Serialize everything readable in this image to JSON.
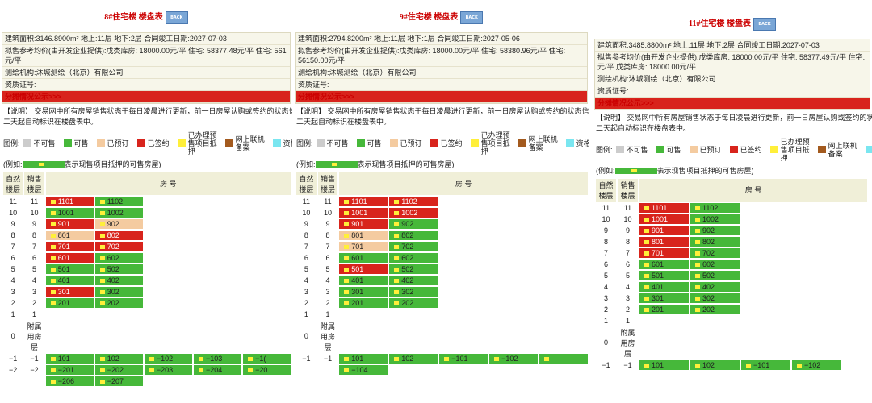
{
  "common": {
    "back_icon_text": "BACK",
    "notice": "【说明】 交易网中所有房屋销售状态于每日凌晨进行更新，前一日房屋认购或签约的状态信息",
    "notice2": "二天起自动标识在楼盘表中。",
    "legend_label": "图例:",
    "legend": [
      "不可售",
      "可售",
      "已预订",
      "已签约",
      "已办理预售项目抵押",
      "网上联机备案",
      "资格中"
    ],
    "example_prefix": "(例如:",
    "example_suffix": "表示现售项目抵押的可售房屋)",
    "hdr_natural": "自然楼层",
    "hdr_sale": "销售楼层",
    "hdr_room": "房 号",
    "annex": "附属用房层",
    "colors": {
      "green": "#46b83a",
      "red": "#d8241c",
      "peach": "#f4cba0",
      "yellow": "#ffef3a",
      "gray": "#cccccc"
    }
  },
  "panels": [
    {
      "title": "8#住宅楼 楼盘表",
      "area": "建筑面积:3146.8900m²  地上:11层  地下:2层  合同竣工日期:2027-07-03",
      "price": "拟售参考均价(由开发企业提供):戊类库房:  18000.00元/平 住宅:  58377.48元/平 住宅:  561",
      "price2": "元/平",
      "surveyor": "测绘机构:沐城测绘（北京）有限公司",
      "cert": "资质证号:",
      "notice_link": "分摊情况公示>>>",
      "rows": [
        {
          "n": "11",
          "s": "11",
          "cells": [
            {
              "r": "1101",
              "c": "red"
            },
            {
              "r": "1102",
              "c": "green"
            }
          ]
        },
        {
          "n": "10",
          "s": "10",
          "cells": [
            {
              "r": "1001",
              "c": "green"
            },
            {
              "r": "1002",
              "c": "green"
            }
          ]
        },
        {
          "n": "9",
          "s": "9",
          "cells": [
            {
              "r": "901",
              "c": "red"
            },
            {
              "r": "902",
              "c": "peach"
            }
          ]
        },
        {
          "n": "8",
          "s": "8",
          "cells": [
            {
              "r": "801",
              "c": "peach"
            },
            {
              "r": "802",
              "c": "red"
            }
          ]
        },
        {
          "n": "7",
          "s": "7",
          "cells": [
            {
              "r": "701",
              "c": "red"
            },
            {
              "r": "702",
              "c": "red"
            }
          ]
        },
        {
          "n": "6",
          "s": "6",
          "cells": [
            {
              "r": "601",
              "c": "red"
            },
            {
              "r": "602",
              "c": "green"
            }
          ]
        },
        {
          "n": "5",
          "s": "5",
          "cells": [
            {
              "r": "501",
              "c": "green"
            },
            {
              "r": "502",
              "c": "green"
            }
          ]
        },
        {
          "n": "4",
          "s": "4",
          "cells": [
            {
              "r": "401",
              "c": "green"
            },
            {
              "r": "402",
              "c": "green"
            }
          ]
        },
        {
          "n": "3",
          "s": "3",
          "cells": [
            {
              "r": "301",
              "c": "red"
            },
            {
              "r": "302",
              "c": "green"
            }
          ]
        },
        {
          "n": "2",
          "s": "2",
          "cells": [
            {
              "r": "201",
              "c": "green"
            },
            {
              "r": "202",
              "c": "green"
            }
          ]
        },
        {
          "n": "1",
          "s": "1",
          "cells": []
        },
        {
          "n": "0",
          "s": "附属用房层",
          "cells": []
        },
        {
          "n": "−1",
          "s": "−1",
          "cells": [
            {
              "r": "101",
              "c": "green"
            },
            {
              "r": "102",
              "c": "green"
            },
            {
              "r": "−102",
              "c": "green"
            },
            {
              "r": "−103",
              "c": "green"
            },
            {
              "r": "−1(",
              "c": "green"
            }
          ]
        },
        {
          "n": "−2",
          "s": "−2",
          "cells": [
            {
              "r": "−201",
              "c": "green"
            },
            {
              "r": "−202",
              "c": "green"
            },
            {
              "r": "−203",
              "c": "green"
            },
            {
              "r": "−204",
              "c": "green"
            },
            {
              "r": "−20",
              "c": "green"
            }
          ]
        },
        {
          "n": "",
          "s": "",
          "cells": [
            {
              "r": "−206",
              "c": "green"
            },
            {
              "r": "−207",
              "c": "green"
            }
          ]
        }
      ]
    },
    {
      "title": "9#住宅楼 楼盘表",
      "area": "建筑面积:2794.8200m²  地上:11层  地下:1层  合同竣工日期:2027-05-06",
      "price": "拟售参考均价(由开发企业提供):戊类库房:  18000.00元/平 住宅:  58380.96元/平 住宅:",
      "price2": "56150.00元/平",
      "surveyor": "测绘机构:沐城测绘（北京）有限公司",
      "cert": "资质证号:",
      "notice_link": "分摊情况公示>>>",
      "rows": [
        {
          "n": "11",
          "s": "11",
          "cells": [
            {
              "r": "1101",
              "c": "red"
            },
            {
              "r": "1102",
              "c": "red"
            }
          ]
        },
        {
          "n": "10",
          "s": "10",
          "cells": [
            {
              "r": "1001",
              "c": "red"
            },
            {
              "r": "1002",
              "c": "red"
            }
          ]
        },
        {
          "n": "9",
          "s": "9",
          "cells": [
            {
              "r": "901",
              "c": "red"
            },
            {
              "r": "902",
              "c": "green"
            }
          ]
        },
        {
          "n": "8",
          "s": "8",
          "cells": [
            {
              "r": "801",
              "c": "peach"
            },
            {
              "r": "802",
              "c": "green"
            }
          ]
        },
        {
          "n": "7",
          "s": "7",
          "cells": [
            {
              "r": "701",
              "c": "peach"
            },
            {
              "r": "702",
              "c": "green"
            }
          ]
        },
        {
          "n": "6",
          "s": "6",
          "cells": [
            {
              "r": "601",
              "c": "green"
            },
            {
              "r": "602",
              "c": "green"
            }
          ]
        },
        {
          "n": "5",
          "s": "5",
          "cells": [
            {
              "r": "501",
              "c": "red"
            },
            {
              "r": "502",
              "c": "green"
            }
          ]
        },
        {
          "n": "4",
          "s": "4",
          "cells": [
            {
              "r": "401",
              "c": "green"
            },
            {
              "r": "402",
              "c": "green"
            }
          ]
        },
        {
          "n": "3",
          "s": "3",
          "cells": [
            {
              "r": "301",
              "c": "green"
            },
            {
              "r": "302",
              "c": "green"
            }
          ]
        },
        {
          "n": "2",
          "s": "2",
          "cells": [
            {
              "r": "201",
              "c": "green"
            },
            {
              "r": "202",
              "c": "green"
            }
          ]
        },
        {
          "n": "1",
          "s": "1",
          "cells": []
        },
        {
          "n": "0",
          "s": "附属用房层",
          "cells": []
        },
        {
          "n": "−1",
          "s": "−1",
          "cells": [
            {
              "r": "101",
              "c": "green"
            },
            {
              "r": "102",
              "c": "green"
            },
            {
              "r": "−101",
              "c": "green"
            },
            {
              "r": "−102",
              "c": "green"
            },
            {
              "r": "",
              "c": "green"
            }
          ]
        },
        {
          "n": "",
          "s": "",
          "cells": [
            {
              "r": "−104",
              "c": "green"
            }
          ]
        }
      ]
    },
    {
      "title": "11#住宅楼 楼盘表",
      "area": "建筑面积:3485.8800m²  地上:11层  地下:2层  合同竣工日期:2027-07-03",
      "price": "拟售参考均价(由开发企业提供):戊类库房:  18000.00元/平 住宅:  58377.49元/平 住宅:",
      "price2": "元/平 戊类库房:  18000.00元/平",
      "surveyor": "测绘机构:沐城测绘（北京）有限公司",
      "cert": "资质证号:",
      "notice_link": "分摊情况公示>>>",
      "rows": [
        {
          "n": "11",
          "s": "11",
          "cells": [
            {
              "r": "1101",
              "c": "red"
            },
            {
              "r": "1102",
              "c": "green"
            }
          ]
        },
        {
          "n": "10",
          "s": "10",
          "cells": [
            {
              "r": "1001",
              "c": "red"
            },
            {
              "r": "1002",
              "c": "green"
            }
          ]
        },
        {
          "n": "9",
          "s": "9",
          "cells": [
            {
              "r": "901",
              "c": "red"
            },
            {
              "r": "902",
              "c": "green"
            }
          ]
        },
        {
          "n": "8",
          "s": "8",
          "cells": [
            {
              "r": "801",
              "c": "red"
            },
            {
              "r": "802",
              "c": "green"
            }
          ]
        },
        {
          "n": "7",
          "s": "7",
          "cells": [
            {
              "r": "701",
              "c": "red"
            },
            {
              "r": "702",
              "c": "green"
            }
          ]
        },
        {
          "n": "6",
          "s": "6",
          "cells": [
            {
              "r": "601",
              "c": "green"
            },
            {
              "r": "602",
              "c": "green"
            }
          ]
        },
        {
          "n": "5",
          "s": "5",
          "cells": [
            {
              "r": "501",
              "c": "green"
            },
            {
              "r": "502",
              "c": "green"
            }
          ]
        },
        {
          "n": "4",
          "s": "4",
          "cells": [
            {
              "r": "401",
              "c": "green"
            },
            {
              "r": "402",
              "c": "green"
            }
          ]
        },
        {
          "n": "3",
          "s": "3",
          "cells": [
            {
              "r": "301",
              "c": "green"
            },
            {
              "r": "302",
              "c": "green"
            }
          ]
        },
        {
          "n": "2",
          "s": "2",
          "cells": [
            {
              "r": "201",
              "c": "green"
            },
            {
              "r": "202",
              "c": "green"
            }
          ]
        },
        {
          "n": "1",
          "s": "1",
          "cells": []
        },
        {
          "n": "0",
          "s": "附属用房层",
          "cells": []
        },
        {
          "n": "−1",
          "s": "−1",
          "cells": [
            {
              "r": "101",
              "c": "green"
            },
            {
              "r": "102",
              "c": "green"
            },
            {
              "r": "−101",
              "c": "green"
            },
            {
              "r": "−102",
              "c": "green"
            }
          ]
        }
      ]
    }
  ]
}
